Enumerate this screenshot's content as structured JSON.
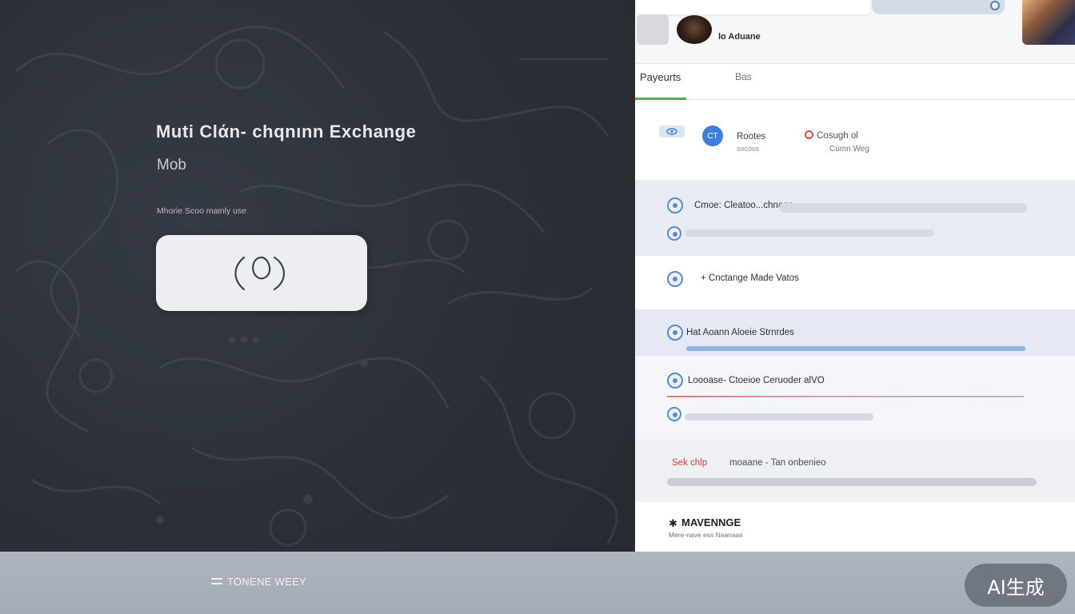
{
  "hero": {
    "title": "Muti  Clάn- chqnınn  Exchange",
    "subtitle": "Mob",
    "caption": "Mhorie    Scoo mainly use",
    "button_icon": "connect-ring-icon"
  },
  "panel": {
    "brand": "lo Aduane",
    "tabs": [
      {
        "label": "Payeurts"
      },
      {
        "label": "Bas"
      }
    ],
    "summary": {
      "badge_icon": "eye-icon",
      "circle_text": "CT",
      "label": "Rootes",
      "sublabel": "socoss",
      "right_label": "Cosugh  ol",
      "right_sublabel": "Cumn Weg"
    },
    "rows": [
      {
        "text": "Cmoe: Cleatoo...chnage"
      },
      {
        "text": "+ Cnctange Made  Vatos"
      },
      {
        "text": "Hat  Aoann Aloeie  Strnrdes"
      },
      {
        "text": "Loooase- Ctoeioe Ceruoder alVO"
      },
      {
        "text_red": "Sek chlp",
        "text": "moaane  - Tan onbenieo"
      }
    ],
    "footer_brand": {
      "icon": "exchange-icon",
      "title": "MAVENNGE",
      "subtitle": "Mere-nave  ess  Naanaas"
    }
  },
  "footer": {
    "icon": "menu-icon",
    "label": "TONENE WEEY"
  },
  "watermark": "AI生成"
}
